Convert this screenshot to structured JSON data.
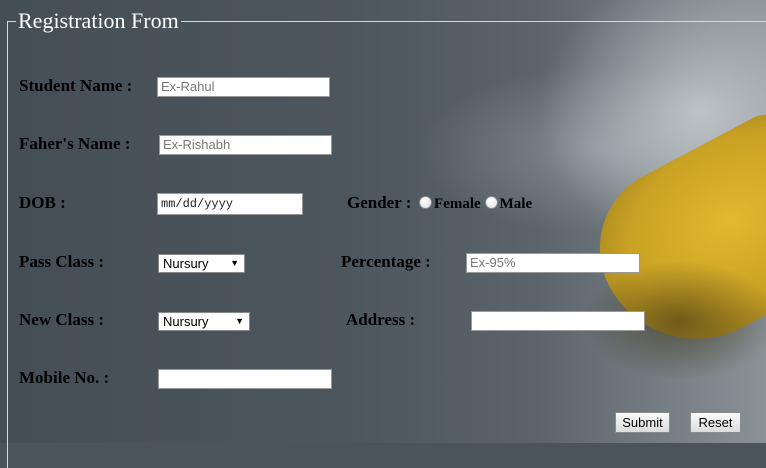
{
  "form": {
    "legend": "Registration From",
    "fields": {
      "student_name": {
        "label": "Student Name :",
        "placeholder": "Ex-Rahul"
      },
      "father_name": {
        "label": "Faher's Name :",
        "placeholder": "Ex-Rishabh"
      },
      "dob": {
        "label": "DOB :",
        "placeholder": "mm/dd/yyyy"
      },
      "gender": {
        "label": "Gender :",
        "options": [
          "Female",
          "Male"
        ]
      },
      "pass_class": {
        "label": "Pass Class :",
        "value": "Nursury"
      },
      "percentage": {
        "label": "Percentage :",
        "placeholder": "Ex-95%"
      },
      "new_class": {
        "label": "New Class :",
        "value": "Nursury"
      },
      "address": {
        "label": "Address :",
        "value": ""
      },
      "mobile": {
        "label": "Mobile No. :",
        "value": ""
      }
    },
    "buttons": {
      "submit": "Submit",
      "reset": "Reset"
    }
  }
}
